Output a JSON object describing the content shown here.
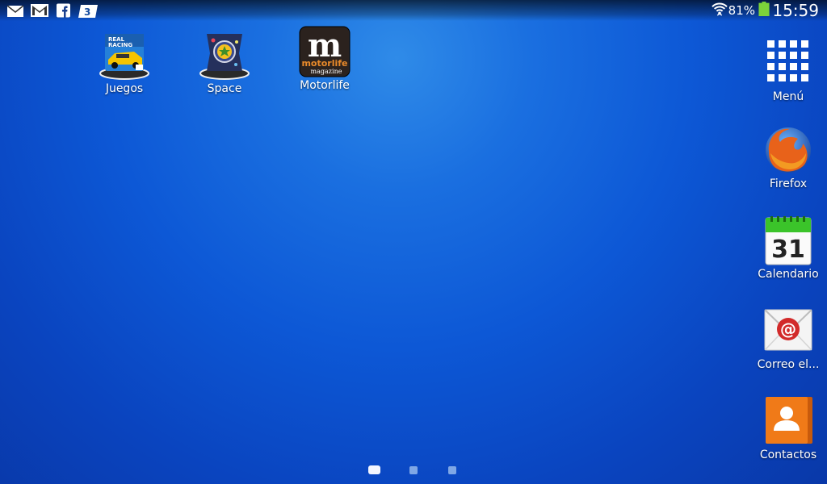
{
  "status_bar": {
    "battery_percent": "81%",
    "time": "15:59",
    "left_icons": [
      "mail-icon",
      "gmail-icon",
      "facebook-icon",
      "calendar-3-icon"
    ],
    "right_icons": [
      "wifi-icon",
      "battery-icon"
    ]
  },
  "home_apps": [
    {
      "label": "Juegos",
      "icon": "real-racing-folder-icon"
    },
    {
      "label": "Space",
      "icon": "space-folder-icon"
    },
    {
      "label": "Motorlife",
      "icon": "motorlife-icon",
      "icon_text_big": "m",
      "icon_text_1": "motorlife",
      "icon_text_2": "magazine"
    }
  ],
  "dock": [
    {
      "label": "Menú",
      "icon": "apps-grid-icon"
    },
    {
      "label": "Firefox",
      "icon": "firefox-icon"
    },
    {
      "label": "Calendario",
      "icon": "calendar-icon",
      "icon_text": "31"
    },
    {
      "label": "Correo el...",
      "icon": "email-icon",
      "icon_text": "@"
    },
    {
      "label": "Contactos",
      "icon": "contacts-icon"
    }
  ],
  "page_indicator": {
    "pages": 3,
    "current": 1
  },
  "colors": {
    "accent_green": "#4caf1f",
    "contacts_orange": "#f07a18",
    "calendar_green": "#3bc42a"
  }
}
